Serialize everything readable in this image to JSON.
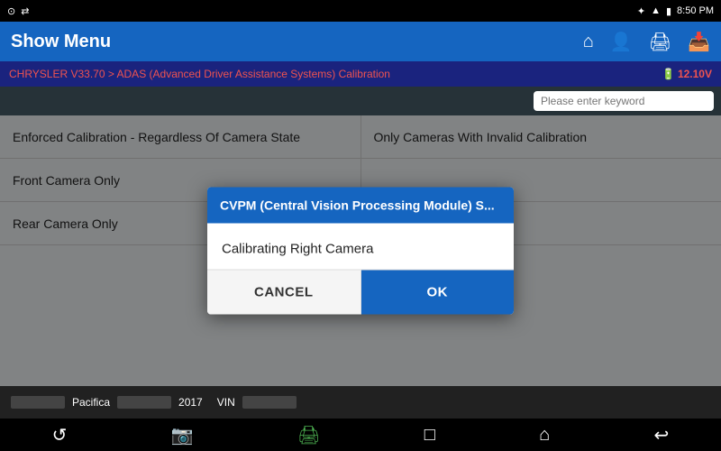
{
  "statusBar": {
    "leftIcon1": "⊙",
    "leftIcon2": "⇄",
    "time": "8:50 PM",
    "bluetoothIcon": "✦",
    "wifiIcon": "▲",
    "batteryIcon": "▮"
  },
  "header": {
    "title": "Show Menu",
    "homeIcon": "⌂",
    "personIcon": "👤",
    "printIcon": "🖨",
    "downloadIcon": "📥"
  },
  "breadcrumb": {
    "text": "CHRYSLER V33.70 > ADAS (Advanced Driver Assistance Systems) Calibration",
    "voltage": "12.10V"
  },
  "search": {
    "placeholder": "Please enter keyword"
  },
  "tableRows": [
    {
      "col1": "Enforced Calibration - Regardless Of Camera State",
      "col2": "Only Cameras With Invalid Calibration"
    },
    {
      "col1": "Front Camera Only",
      "col2": ""
    },
    {
      "col1": "Rear Camera Only",
      "col2": ""
    }
  ],
  "dialog": {
    "title": "CVPM (Central Vision Processing Module) S...",
    "message": "Calibrating Right Camera",
    "cancelLabel": "CANCEL",
    "okLabel": "OK"
  },
  "infoBar": {
    "model": "Pacifica",
    "year": "2017",
    "vinLabel": "VIN"
  },
  "bottomNav": {
    "icon1": "↺",
    "icon2": "📷",
    "icon3": "🖨",
    "icon4": "□",
    "icon5": "⌂",
    "icon6": "↩"
  }
}
